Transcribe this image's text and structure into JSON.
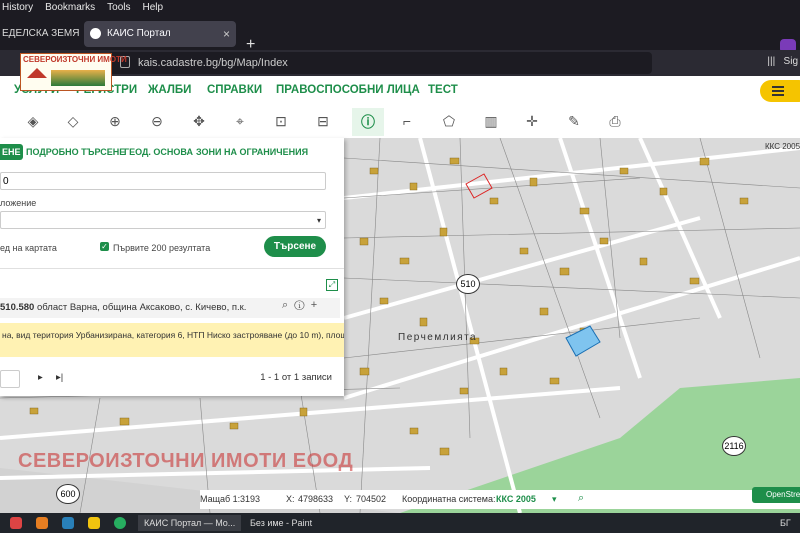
{
  "browser": {
    "menu": [
      "History",
      "Bookmarks",
      "Tools",
      "Help"
    ],
    "tabs": [
      {
        "label": "ЕДЕЛСКА ЗЕМЯ з"
      },
      {
        "label": "КАИС Портал",
        "close": "×"
      }
    ],
    "new_tab": "+",
    "url": "kais.cadastre.bg/bg/Map/Index",
    "right_label": "Sig"
  },
  "logo": {
    "text": "СЕВЕРОИЗТОЧНИ ИМОТИ"
  },
  "site_nav": {
    "items": [
      "УСЛУГИ",
      "РЕГИСТРИ",
      "ЖАЛБИ",
      "СПРАВКИ",
      "ПРАВОСПОСОБНИ ЛИЦА",
      "ТЕСТ"
    ]
  },
  "toolbar": {
    "tools": [
      "layers-icon",
      "stack-icon",
      "zoom-in-icon",
      "zoom-out-icon",
      "pan-icon",
      "location-pin-icon",
      "add-area-icon",
      "remove-area-icon",
      "info-icon",
      "corner-icon",
      "polygon-icon",
      "map-icon",
      "crosshair-icon",
      "edit-doc-icon",
      "print-icon"
    ]
  },
  "search_panel": {
    "tabs": [
      "ЕНЕ",
      "ПОДРОБНО ТЪРСЕНЕ",
      "ГЕОД. ОСНОВА",
      "ЗОНИ НА ОГРАНИЧЕНИЯ"
    ],
    "input_value": "0",
    "location_label": "ложение",
    "select_arrow": "▾",
    "option_map": "ед на картата",
    "option_first200": "Първите 200 резултата",
    "search_button": "Търсене",
    "result_title": "510.580",
    "result_location": "област Варна, община Аксаково, с. Кичево, п.к.",
    "result_detail": "на, вид територия Урбанизирана, категория 6, НТП Ниско застрояване (до 10 m), площ 834",
    "pager_text": "1 - 1 от 1 записи",
    "next_icon": "▸",
    "last_icon": "▸|",
    "expand_icon": "⤢"
  },
  "map": {
    "locality_label": "Перчемлията",
    "road_labels": [
      "510",
      "600",
      "2116"
    ],
    "watermark": "СЕВЕРОИЗТОЧНИ ИМОТИ ЕООД",
    "corner_label": "ККС 2005",
    "osm": "OpenStree"
  },
  "status": {
    "scale_label": "Мащаб 1:",
    "scale_value": "3193",
    "x_label": "X:",
    "x_value": "4798633",
    "y_label": "Y:",
    "y_value": "704502",
    "crs_label": "Координатна система:",
    "crs_value": "ККС 2005"
  },
  "taskbar": {
    "apps": [
      "КАИС Портал — Mo...",
      "Без име - Paint"
    ],
    "tray": "БГ"
  },
  "colors": {
    "accent": "#1e8e4a",
    "highlight": "#fff2b3",
    "login": "#f5c400"
  }
}
